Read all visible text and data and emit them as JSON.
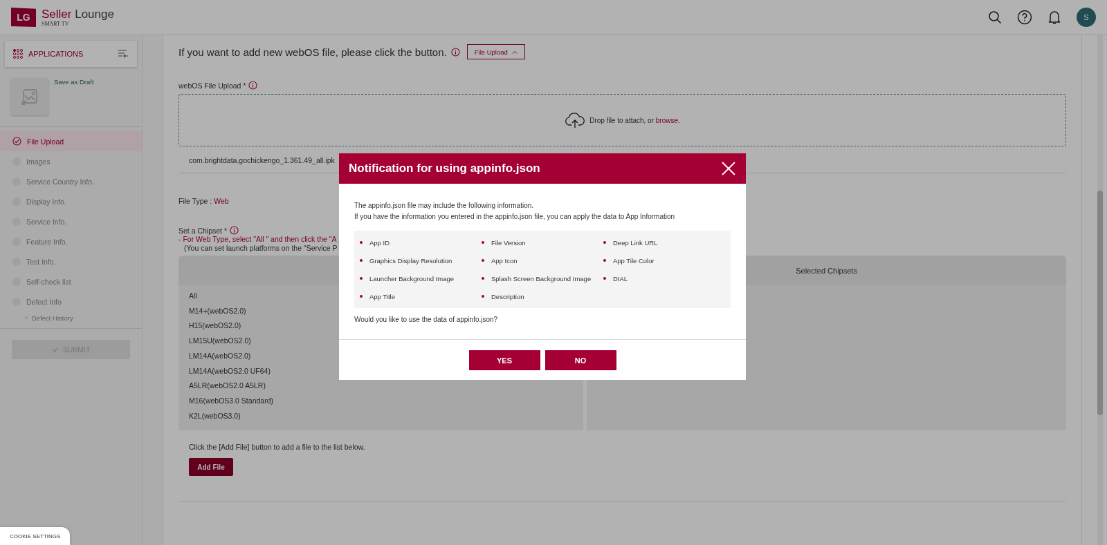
{
  "header": {
    "logo_mark": "LG",
    "brand": "Seller",
    "brand_rest": "Lounge",
    "subtitle": "SMART TV",
    "avatar_initial": "S"
  },
  "sidebar": {
    "title": "APPLICATIONS",
    "draft_label": "Save as Draft",
    "steps": [
      {
        "label": "File Upload",
        "selected": true
      },
      {
        "label": "Images",
        "selected": false
      },
      {
        "label": "Service Country Info.",
        "selected": false
      },
      {
        "label": "Display Info.",
        "selected": false
      },
      {
        "label": "Service Info.",
        "selected": false
      },
      {
        "label": "Feature Info.",
        "selected": false
      },
      {
        "label": "Test Info.",
        "selected": false
      },
      {
        "label": "Self-check list",
        "selected": false
      },
      {
        "label": "Defect Info",
        "selected": false,
        "children": [
          {
            "label": "Defect History",
            "selected": false
          }
        ]
      }
    ],
    "submit": {
      "label": "SUBMIT",
      "disabled": true
    }
  },
  "main": {
    "intro": "If you want to add new webOS file, please click the button.",
    "file_upload_button": "File Upload",
    "upload_label": "webOS File Upload *",
    "dropzone_text": "Drop file to attach, or",
    "dropzone_link": "browse.",
    "file_name": "com.brightdata.gochickengo_1.361.49_all.ipk",
    "file_type_label": "File Type :",
    "file_type_value": "Web",
    "chipset_label": "Set a Chipset *",
    "chipset_notes": [
      "- For Web Type, select \"All \"  and then click the \"A",
      "(You can set launch platforms on the \"Service P"
    ],
    "chipsets": [
      "All",
      "M14+(webOS2.0)",
      "H15(webOS2.0)",
      "LM15U(webOS2.0)",
      "LM14A(webOS2.0)",
      "LM14A(webOS2.0 UF64)",
      "A5LR(webOS2.0 A5LR)",
      "M16(webOS3.0 Standard)",
      "K2L(webOS3.0)"
    ],
    "selected_header": "Selected Chipsets",
    "add_file_note": "Click the [Add File] button to add a file to the list below.",
    "add_file_button": "Add File"
  },
  "modal": {
    "title": "Notification for using appinfo.json",
    "lines": [
      "The appinfo.json file may include the following information.",
      "If you have the information you entered in the appinfo.json file, you can apply the data to App Information"
    ],
    "items": [
      "App ID",
      "File Version",
      "Deep Link URL",
      "Graphics Display Resolution",
      "App Icon",
      "App Tile Color",
      "Launcher Background Image",
      "Splash Screen Background Image",
      "DIAL",
      "App Title",
      "Description"
    ],
    "question": "Would you like to use the data of appinfo.json?",
    "buttons": [
      "YES",
      "NO"
    ]
  },
  "cookie_button": "COOKIE SETTINGS"
}
